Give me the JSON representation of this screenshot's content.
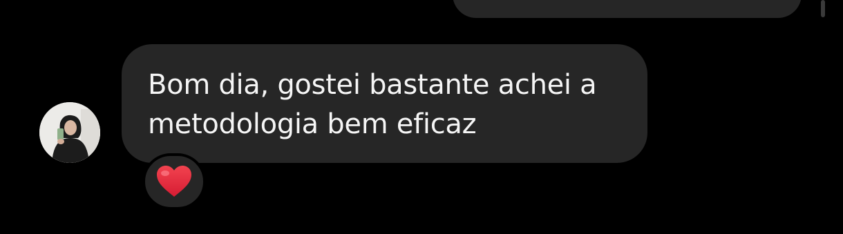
{
  "thread": {
    "previous_message": {
      "direction": "outgoing",
      "text": ""
    },
    "message": {
      "direction": "incoming",
      "text": "Bom dia, gostei bastante achei a\nmetodologia bem eficaz",
      "reaction": "❤️"
    }
  },
  "colors": {
    "background": "#000000",
    "bubble": "#262626",
    "text": "#f5f5f5",
    "heart": "#e2243b"
  },
  "icons": {
    "reaction": "red-heart-icon",
    "avatar": "profile-photo"
  }
}
